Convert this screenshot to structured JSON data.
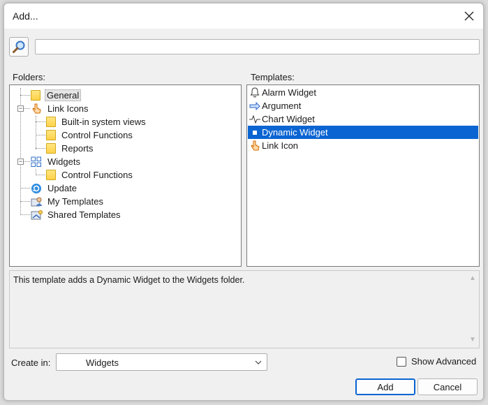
{
  "window": {
    "title": "Add..."
  },
  "search": {
    "value": "",
    "placeholder": ""
  },
  "folders": {
    "label": "Folders:",
    "items": [
      {
        "label": "General",
        "icon": "folder-icon",
        "selected": true
      },
      {
        "label": "Link Icons",
        "icon": "hand-pointer-icon",
        "expanded": true
      },
      {
        "label": "Built-in system views",
        "icon": "folder-icon"
      },
      {
        "label": "Control Functions",
        "icon": "folder-icon"
      },
      {
        "label": "Reports",
        "icon": "folder-icon"
      },
      {
        "label": "Widgets",
        "icon": "widgets-grid-icon",
        "expanded": true
      },
      {
        "label": "Control Functions",
        "icon": "folder-icon"
      },
      {
        "label": "Update",
        "icon": "update-icon"
      },
      {
        "label": "My Templates",
        "icon": "user-templates-icon"
      },
      {
        "label": "Shared Templates",
        "icon": "shared-templates-icon"
      }
    ]
  },
  "templates": {
    "label": "Templates:",
    "items": [
      {
        "label": "Alarm Widget",
        "icon": "bell-icon"
      },
      {
        "label": "Argument",
        "icon": "arrow-right-icon"
      },
      {
        "label": "Chart Widget",
        "icon": "pulse-icon"
      },
      {
        "label": "Dynamic Widget",
        "icon": "square-icon",
        "selected": true
      },
      {
        "label": "Link Icon",
        "icon": "hand-pointer-icon"
      }
    ]
  },
  "description": {
    "text": "This template adds a Dynamic Widget to the Widgets folder."
  },
  "create_in": {
    "label": "Create in:",
    "value": "Widgets"
  },
  "show_advanced": {
    "label": "Show Advanced",
    "checked": false
  },
  "buttons": {
    "add": "Add",
    "cancel": "Cancel"
  },
  "colors": {
    "selection": "#0a64d2",
    "folder": "#ffd24a"
  }
}
